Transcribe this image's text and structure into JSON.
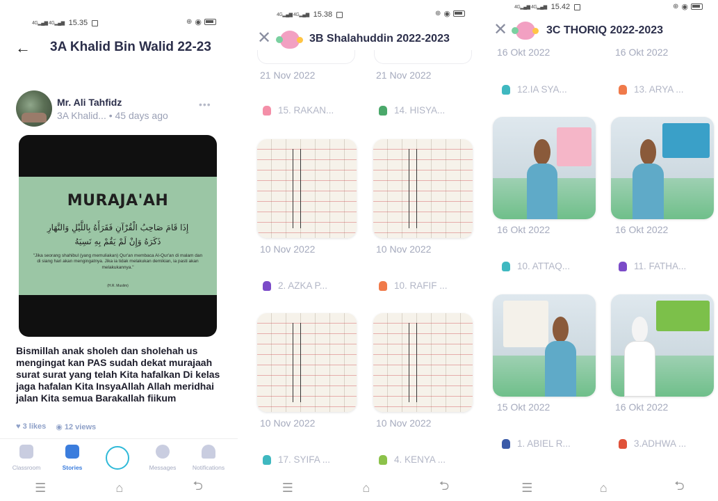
{
  "screen1": {
    "status_time": "15.35",
    "title": "3A Khalid Bin Walid 22-23",
    "teacher_name": "Mr. Ali Tahfidz",
    "meta": "3A Khalid... • 45 days ago",
    "more_icon": "more-icon",
    "post_image": {
      "title": "MURAJA'AH",
      "arabic_line1": "إِذَا قَامَ صَاحِبُ الْقُرْآنِ فَقَرَأَهُ بِاللَّيْلِ وَالنَّهَارِ",
      "arabic_line2": "ذَكَرَهُ وَإِنْ لَمْ يَقُمْ بِهِ نَسِيَهُ",
      "quote": "\"Jika seorang shahibul (yang memuliakan) Qur'an membaca Al-Qur'an di malam dan di siang hari akan mengingatnya. Jika ia tidak melakukan demikian, ia pasti akan melakukannya.\"",
      "source": "(H.R. Muslim)"
    },
    "caption": "Bismillah anak sholeh dan sholehah us mengingat kan PAS sudah dekat murajaah surat surat yang telah Kita hafalkan Di kelas jaga hafalan Kita InsyaAllah Allah meridhai jalan Kita semua Barakallah fiikum",
    "likes": "3 likes",
    "views": "12 views",
    "tabs": [
      {
        "label": "Classroom",
        "icon": "classroom-icon",
        "active": false
      },
      {
        "label": "Stories",
        "icon": "stories-icon",
        "active": true
      },
      {
        "label": "Messages",
        "icon": "messages-icon",
        "active": false
      },
      {
        "label": "Notifications",
        "icon": "bell-icon",
        "active": false
      }
    ]
  },
  "screen2": {
    "status_time": "15.38",
    "title": "3B Shalahuddin 2022-2023",
    "dates_top": [
      "21 Nov 2022",
      "21 Nov 2022"
    ],
    "row1": [
      "15. RAKAN...",
      "14. HISYA..."
    ],
    "dates_mid": [
      "10 Nov 2022",
      "10 Nov 2022"
    ],
    "row2": [
      "2. AZKA P...",
      "10. RAFIF ..."
    ],
    "dates_bottom": [
      "10 Nov 2022",
      "10 Nov 2022"
    ],
    "row3": [
      "17. SYIFA ...",
      "4. KENYA ..."
    ]
  },
  "screen3": {
    "status_time": "15.42",
    "title": "3C THORIQ 2022-2023",
    "dates_top": [
      "16 Okt 2022",
      "16 Okt 2022"
    ],
    "row1": [
      "12.IA SYA...",
      "13. ARYA ..."
    ],
    "dates_mid": [
      "16 Okt 2022",
      "16 Okt 2022"
    ],
    "row2": [
      "10. ATTAQ...",
      "11. FATHA..."
    ],
    "dates_bottom": [
      "15 Okt 2022",
      "16 Okt 2022"
    ],
    "row3": [
      "1. ABIEL R...",
      "3.ADHWA ..."
    ]
  },
  "colors": {
    "accent": "#3b7ddd",
    "create_ring": "#2fb9d8",
    "muted": "#a5aabd",
    "title": "#2b2e4a"
  }
}
